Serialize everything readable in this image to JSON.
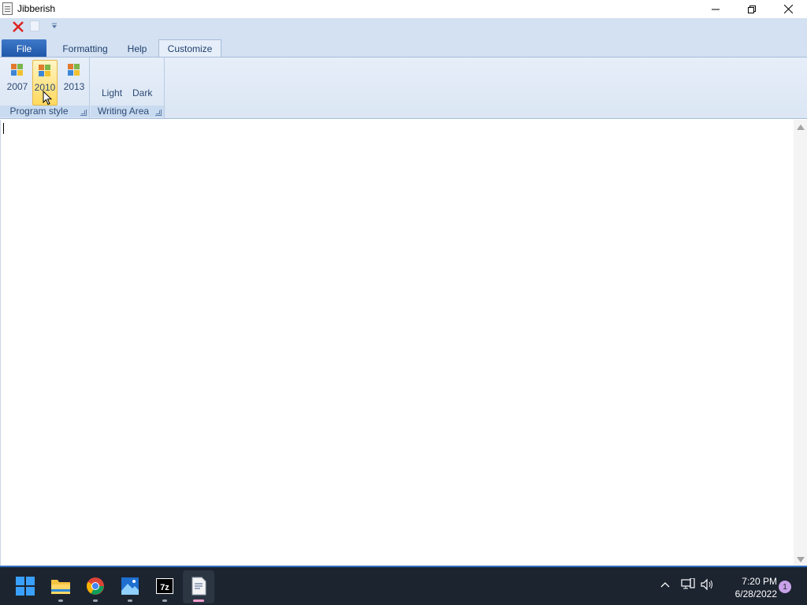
{
  "window": {
    "title": "Jibberish"
  },
  "ribbon": {
    "tabs": [
      {
        "label": "File"
      },
      {
        "label": "Formatting"
      },
      {
        "label": "Help"
      },
      {
        "label": "Customize"
      }
    ],
    "groups": {
      "program_style": {
        "label": "Program style",
        "buttons": [
          {
            "label": "2007"
          },
          {
            "label": "2010"
          },
          {
            "label": "2013"
          }
        ],
        "selected": "2010"
      },
      "writing_area": {
        "label": "Writing Area",
        "buttons": [
          {
            "label": "Light"
          },
          {
            "label": "Dark"
          }
        ]
      }
    }
  },
  "taskbar": {
    "apps": [
      {
        "icon": "windows-start-icon"
      },
      {
        "icon": "file-explorer-icon"
      },
      {
        "icon": "chrome-icon"
      },
      {
        "icon": "photos-icon"
      },
      {
        "icon": "7zip-icon"
      },
      {
        "icon": "jibberish-icon"
      }
    ],
    "tray": {
      "time": "7:20 PM",
      "date": "6/28/2022",
      "notification_count": "1"
    }
  },
  "colors": {
    "ribbon_bg": "#d3e1f2",
    "file_tab": "#2a64b4",
    "selected_button": "#ffd95e",
    "taskbar_bg": "#1c2430",
    "taskbar_accent": "#2f6fbf"
  }
}
